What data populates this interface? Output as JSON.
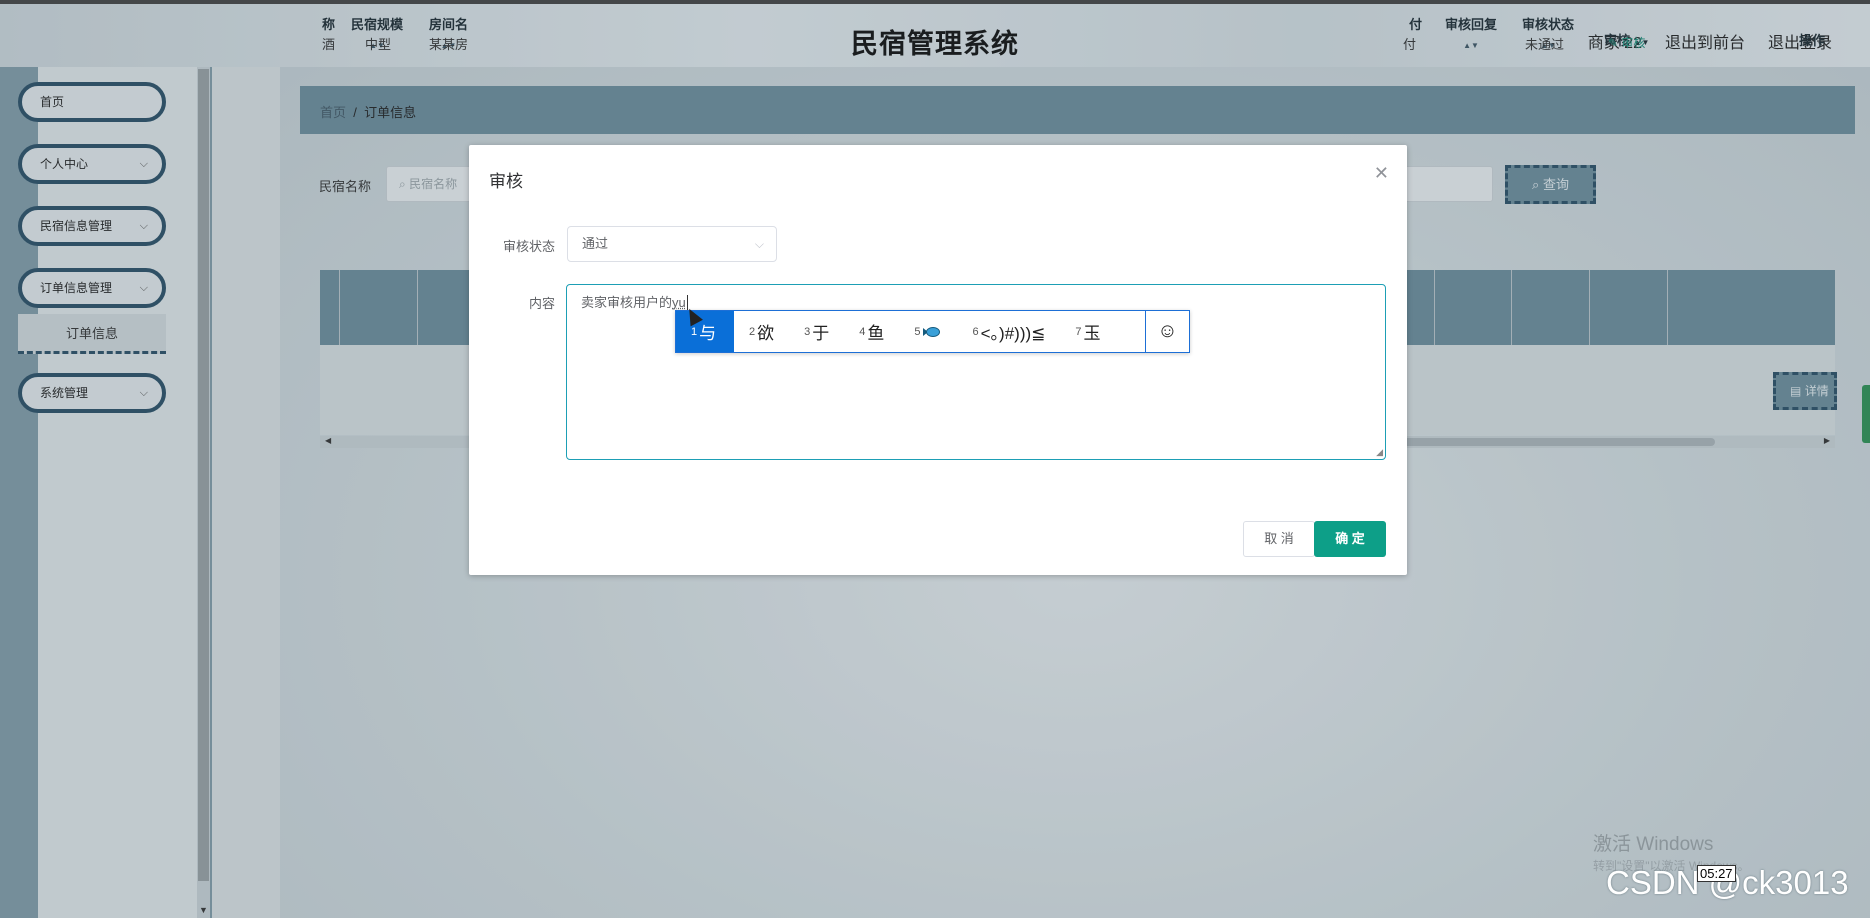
{
  "app": {
    "title": "民宿管理系统",
    "user": "商家 22",
    "back_link": "退出到前台",
    "logout_link": "退出登录"
  },
  "sidebar": {
    "items": [
      {
        "label": "首页"
      },
      {
        "label": "个人中心"
      },
      {
        "label": "民宿信息管理"
      },
      {
        "label": "订单信息管理"
      },
      {
        "label": "系统管理"
      }
    ],
    "active_sub": "订单信息"
  },
  "breadcrumb": {
    "home": "首页",
    "sep": "/",
    "current": "订单信息"
  },
  "search": {
    "label": "民宿名称",
    "placeholder": "民宿名称",
    "query_button": "查询"
  },
  "table": {
    "headers": [
      "称",
      "民宿规模",
      "房间名",
      "付",
      "审核回复",
      "审核状态",
      "审核",
      "操作"
    ],
    "row": {
      "c0": "酒",
      "scale": "中型",
      "room": "某某房",
      "pay": "付",
      "reply": "",
      "status": "未通过",
      "review_link": "审核",
      "detail_button": "详情"
    }
  },
  "dialog": {
    "title": "审核",
    "status_label": "审核状态",
    "status_value": "通过",
    "content_label": "内容",
    "content_text": "卖家审核用户的",
    "content_pinyin": "yu",
    "cancel": "取 消",
    "confirm": "确 定"
  },
  "ime": {
    "candidates": [
      {
        "num": "1",
        "text": "与"
      },
      {
        "num": "2",
        "text": "欲"
      },
      {
        "num": "3",
        "text": "于"
      },
      {
        "num": "4",
        "text": "鱼"
      },
      {
        "num": "5",
        "text": ""
      },
      {
        "num": "6",
        "text": "<。)#)))≦"
      },
      {
        "num": "7",
        "text": "玉"
      }
    ],
    "emoji_button": "☺"
  },
  "overlays": {
    "activate_windows": "激活 Windows",
    "activate_sub": "转到\"设置\"以激活 Windows。",
    "timestamp": "05:27",
    "watermark": "CSDN @ck3013"
  },
  "colors": {
    "accent": "#0d9f88",
    "ime_highlight": "#0a6fd8",
    "header_bg": "#6b8b9a"
  }
}
